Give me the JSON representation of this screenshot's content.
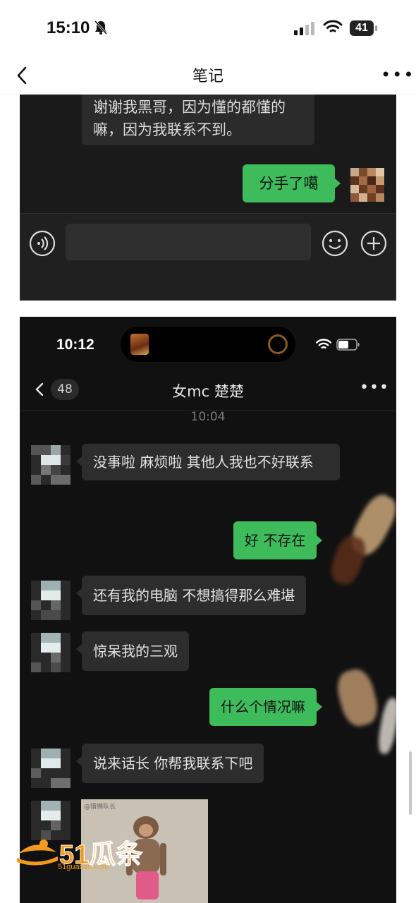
{
  "status_bar": {
    "time": "15:10",
    "battery": "41"
  },
  "nav": {
    "title": "笔记",
    "more": "•••"
  },
  "screenshot1": {
    "received_text": "谢谢我黑哥，因为懂的都懂的嘛，因为我联系不到。",
    "sent_text": "分手了噶"
  },
  "screenshot2": {
    "status_time": "10:12",
    "unread_badge": "48",
    "chat_title": "女mc 楚楚",
    "more": "•••",
    "timestamp": "10:04",
    "messages": [
      {
        "side": "left",
        "text": "没事啦 麻烦啦 其他人我也不好联系"
      },
      {
        "side": "right",
        "text": "好 不存在"
      },
      {
        "side": "left",
        "text": "还有我的电脑 不想搞得那么难堪"
      },
      {
        "side": "left",
        "text": "惊呆我的三观"
      },
      {
        "side": "right",
        "text": "什么个情况嘛"
      },
      {
        "side": "left",
        "text": "说来话长 你帮我联系下吧"
      }
    ],
    "image_caption": "@猎狮队长"
  },
  "watermark": {
    "text": "51瓜条",
    "url": "51guatiao.com"
  },
  "colors": {
    "wechat_green": "#3ebc5c",
    "dark_bg": "#111111",
    "bubble_gray": "#2d2d2d",
    "watermark_orange": "#f39a1e"
  }
}
